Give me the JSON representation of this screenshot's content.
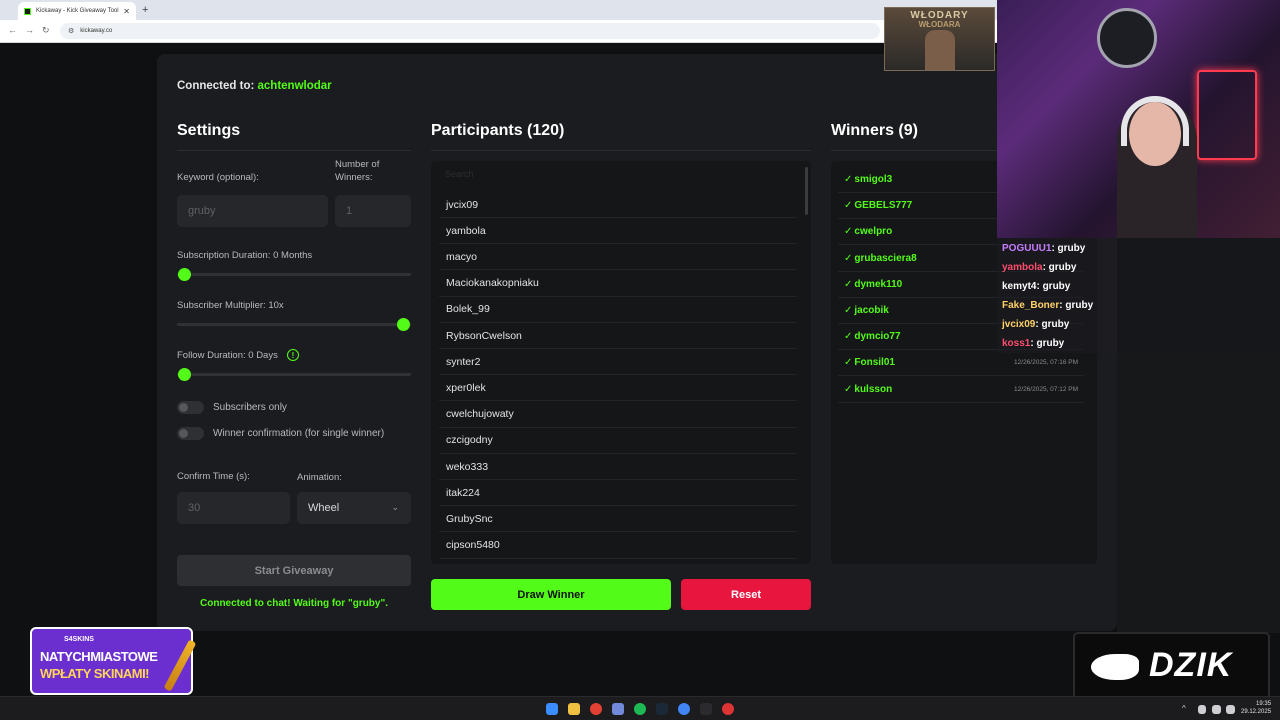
{
  "browser": {
    "tab_title": "Kickaway - Kick Giveaway Tool",
    "tab_close": "✕",
    "new_tab": "+",
    "back": "←",
    "forward": "→",
    "reload": "↻",
    "url": "kickaway.co",
    "url_icon": "⚙"
  },
  "connection": {
    "prefix": "Connected to: ",
    "channel": "achtenwlodar"
  },
  "settings": {
    "title": "Settings",
    "keyword_label": "Keyword (optional):",
    "keyword_value": "gruby",
    "winners_label": "Number of Winners:",
    "winners_value": "1",
    "sub_duration_label": "Subscription Duration: 0 Months",
    "sub_duration_level": 0,
    "sub_multiplier_label": "Subscriber Multiplier: 10x",
    "sub_multiplier_level": 1,
    "follow_duration_label": "Follow Duration: 0 Days",
    "follow_duration_level": 0,
    "info_glyph": "!",
    "subs_only_label": "Subscribers only",
    "winner_confirm_label": "Winner confirmation (for single winner)",
    "confirm_time_label": "Confirm Time (s):",
    "confirm_time_value": "30",
    "animation_label": "Animation:",
    "animation_value": "Wheel",
    "animation_chevron": "⌄",
    "start_button": "Start Giveaway",
    "status": "Connected to chat! Waiting for \"gruby\"."
  },
  "participants": {
    "title": "Participants (120)",
    "search_placeholder": "Search",
    "items": [
      "jvcix09",
      "yambola",
      "macyo",
      "Maciokanakopniaku",
      "Bolek_99",
      "RybsonCwelson",
      "synter2",
      "xper0lek",
      "cwelchujowaty",
      "czcigodny",
      "weko333",
      "itak224",
      "GrubySnc",
      "cipson5480"
    ],
    "draw_button": "Draw Winner",
    "reset_button": "Reset"
  },
  "winners": {
    "title": "Winners (9)",
    "check": "✓",
    "items": [
      {
        "name": "smigol3",
        "date": ""
      },
      {
        "name": "GEBELS777",
        "date": ""
      },
      {
        "name": "cwelpro",
        "date": ""
      },
      {
        "name": "grubasciera8",
        "date": ""
      },
      {
        "name": "dymek110",
        "date": ""
      },
      {
        "name": "jacobik",
        "date": ""
      },
      {
        "name": "dymcio77",
        "date": ""
      },
      {
        "name": "Fonsil01",
        "date": "12/26/2025, 07:16 PM"
      },
      {
        "name": "kulsson",
        "date": "12/26/2025, 07:12 PM"
      }
    ]
  },
  "stream": {
    "logo_title": "WŁODARY",
    "logo_subtitle": "WŁODARA",
    "chat": [
      {
        "user": "POGUUU1",
        "color": "#c77dff",
        "msg": ": gruby"
      },
      {
        "user": "yambola",
        "color": "#ff4d6d",
        "msg": ": gruby"
      },
      {
        "user": "kemyt4",
        "color": "#ffffff",
        "msg": ": gruby"
      },
      {
        "user": "Fake_Boner",
        "color": "#ffd166",
        "msg": ": gruby"
      },
      {
        "user": "jvcix09",
        "color": "#ffd166",
        "msg": ": gruby"
      },
      {
        "user": "koss1",
        "color": "#ff4d6d",
        "msg": ": gruby"
      }
    ],
    "promo_brand": "S4SKINS",
    "promo_line1": "NATYCHMIASTOWE",
    "promo_line2": "WPŁATY SKINAMI!",
    "dzik": "DZIK"
  },
  "taskbar": {
    "time": "19:35",
    "date": "29.12.2025",
    "tray_chevron": "^"
  },
  "colors": {
    "accent": "#53fc18",
    "danger": "#e8163f",
    "panel": "#1b1c1f",
    "background": "#0f1012"
  }
}
